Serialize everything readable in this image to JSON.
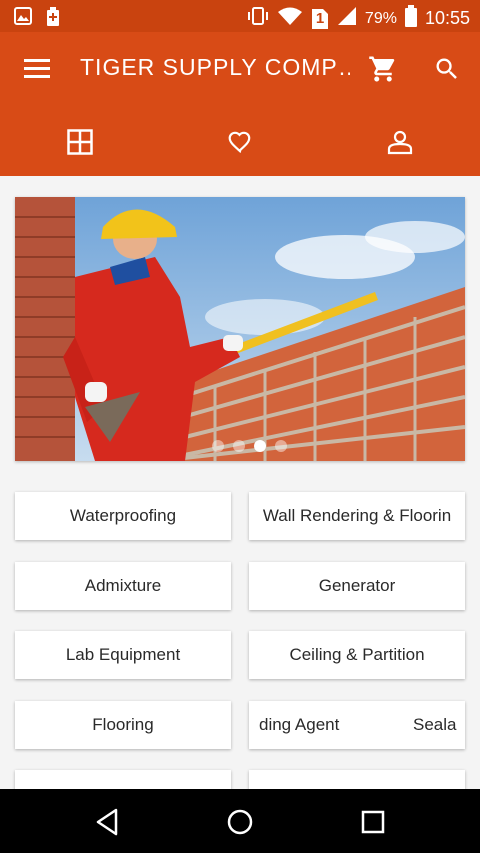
{
  "status_bar": {
    "battery_percent": "79%",
    "time": "10:55",
    "sim_slot": "1",
    "icons": [
      "gallery-icon",
      "battery-saver-icon",
      "vibrate-icon",
      "wifi-icon",
      "sim-icon",
      "signal-icon",
      "battery-icon"
    ]
  },
  "app_bar": {
    "title": "TIGER SUPPLY COMP…",
    "icons": [
      "menu-icon",
      "cart-icon",
      "search-icon"
    ]
  },
  "tabs": [
    {
      "icon": "grid-icon",
      "active": true
    },
    {
      "icon": "heart-icon",
      "active": false
    },
    {
      "icon": "person-icon",
      "active": false
    }
  ],
  "banner": {
    "slide_count": 4,
    "active_slide": 3
  },
  "categories": [
    {
      "label": "Waterproofing"
    },
    {
      "label": "Wall Rendering & Floorin"
    },
    {
      "label": "Admixture"
    },
    {
      "label": "Generator"
    },
    {
      "label": "Lab Equipment"
    },
    {
      "label": "Ceiling & Partition"
    },
    {
      "label": "Flooring"
    },
    {
      "label": "ding Agent",
      "label2": "Seala"
    }
  ],
  "nav_bar": {
    "icons": [
      "back-icon",
      "home-icon",
      "recents-icon"
    ]
  },
  "colors": {
    "app_bar": "#d84b16",
    "status_bar": "#c9430f",
    "background": "#f4f4f4"
  }
}
